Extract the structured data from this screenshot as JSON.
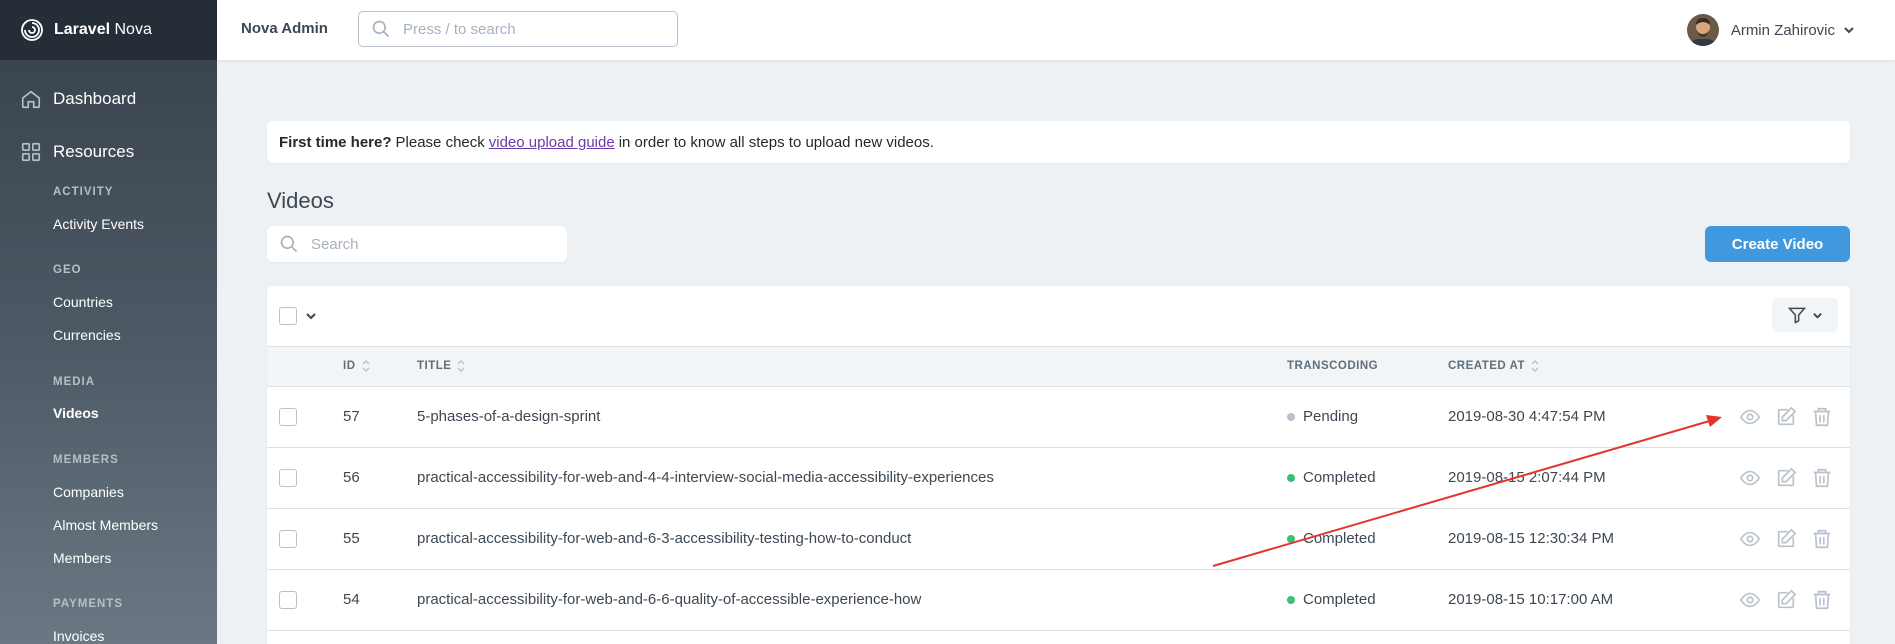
{
  "brand": {
    "bold": "Laravel",
    "light": "Nova"
  },
  "sidebar": {
    "dashboard": "Dashboard",
    "resources": "Resources",
    "groups": [
      {
        "label": "Activity",
        "items": [
          "Activity Events"
        ]
      },
      {
        "label": "Geo",
        "items": [
          "Countries",
          "Currencies"
        ]
      },
      {
        "label": "Media",
        "items": [
          "Videos"
        ]
      },
      {
        "label": "Members",
        "items": [
          "Companies",
          "Almost Members",
          "Members"
        ]
      },
      {
        "label": "Payments",
        "items": [
          "Invoices"
        ]
      }
    ],
    "active_item": "Videos"
  },
  "header": {
    "app_name": "Nova Admin",
    "search_placeholder": "Press / to search",
    "user_name": "Armin Zahirovic"
  },
  "notice": {
    "bold": "First time here?",
    "before_link": "Please check",
    "link": "video upload guide",
    "after_link": "in order to know all steps to upload new videos."
  },
  "page": {
    "title": "Videos",
    "search_placeholder": "Search",
    "create_button": "Create Video"
  },
  "table": {
    "columns": {
      "id": "ID",
      "title": "TITLE",
      "transcoding": "TRANSCODING",
      "created_at": "CREATED AT"
    },
    "rows": [
      {
        "id": "57",
        "title": "5-phases-of-a-design-sprint",
        "transcoding": "Pending",
        "created_at": "2019-08-30 4:47:54 PM"
      },
      {
        "id": "56",
        "title": "practical-accessibility-for-web-and-4-4-interview-social-media-accessibility-experiences",
        "transcoding": "Completed",
        "created_at": "2019-08-15 2:07:44 PM"
      },
      {
        "id": "55",
        "title": "practical-accessibility-for-web-and-6-3-accessibility-testing-how-to-conduct",
        "transcoding": "Completed",
        "created_at": "2019-08-15 12:30:34 PM"
      },
      {
        "id": "54",
        "title": "practical-accessibility-for-web-and-6-6-quality-of-accessible-experience-how",
        "transcoding": "Completed",
        "created_at": "2019-08-15 10:17:00 AM"
      }
    ]
  },
  "colors": {
    "pending": "#b8c2cc",
    "completed": "#38c172",
    "primary": "#4099de",
    "annotation_arrow": "#e3342f"
  },
  "icons": [
    "nova-logo-icon",
    "home-icon",
    "grid-icon",
    "search-icon",
    "chevron-down-icon",
    "filter-icon",
    "sort-icon",
    "view-icon",
    "edit-icon",
    "delete-icon"
  ]
}
